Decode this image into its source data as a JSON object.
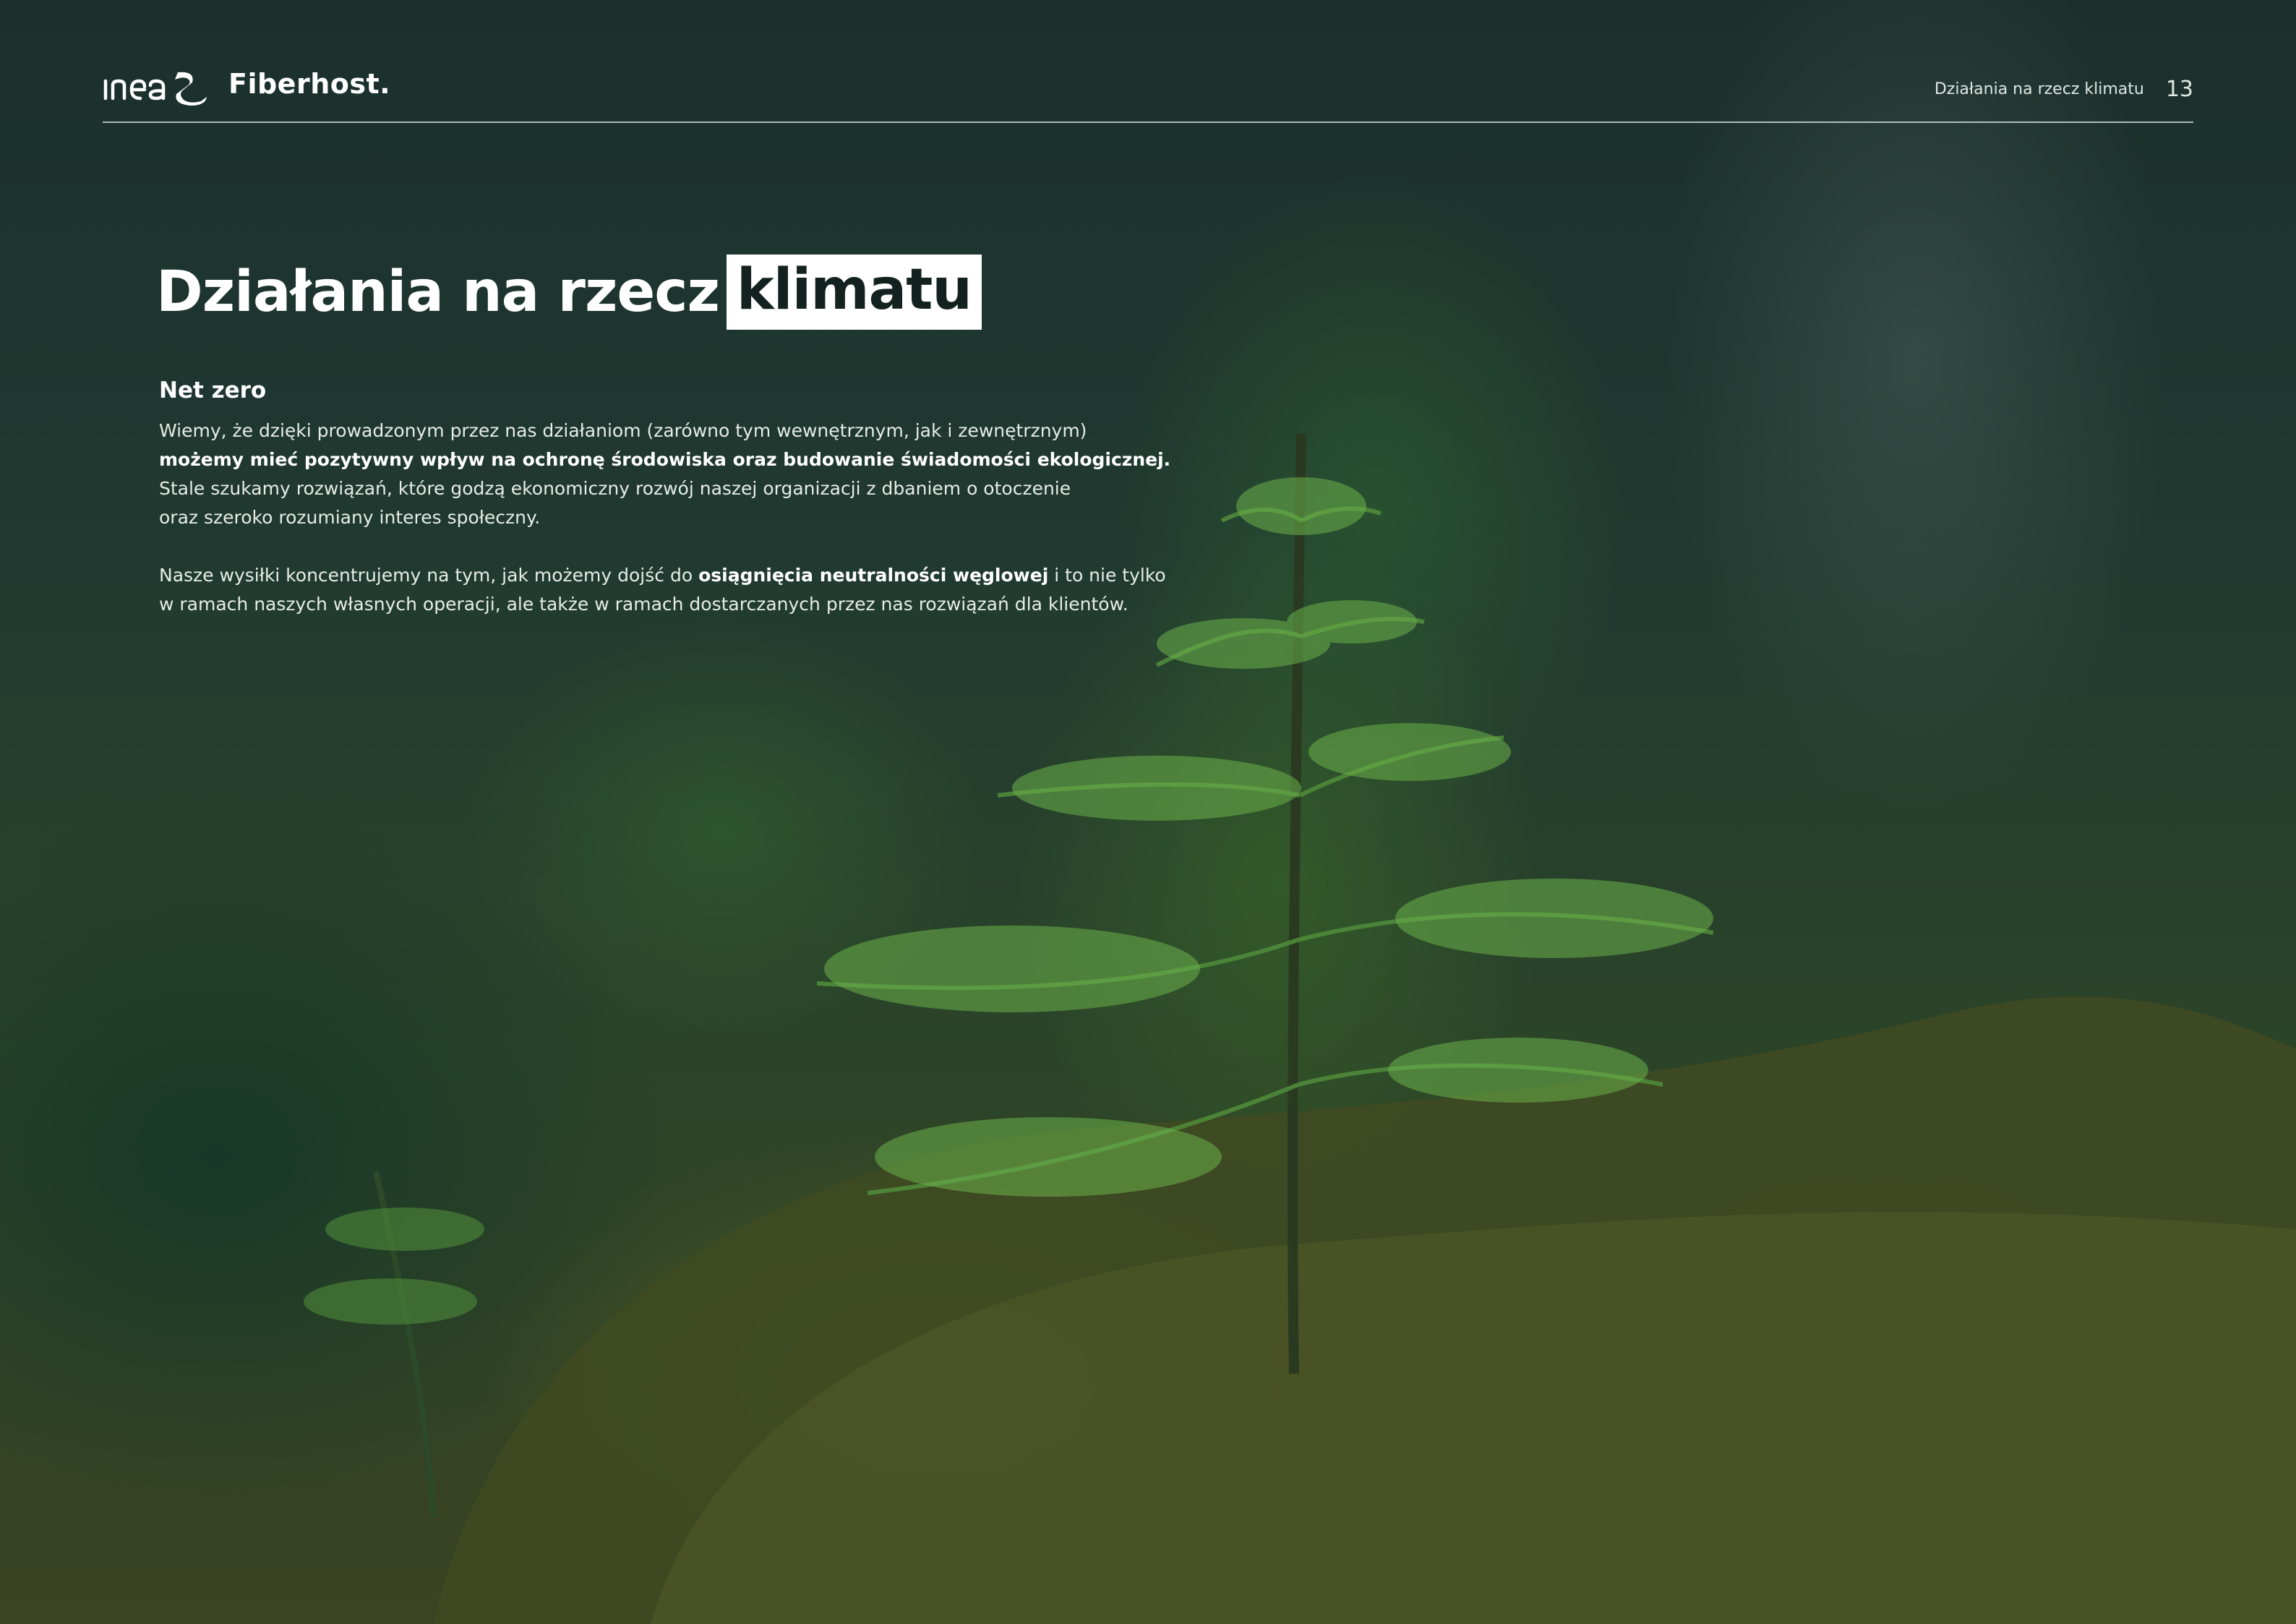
{
  "header": {
    "logo_primary": "inea",
    "logo_secondary": "Fiberhost.",
    "section_label": "Działania na rzecz klimatu",
    "page_number": "13"
  },
  "title": {
    "main": "Działania na rzecz",
    "highlight": "klimatu"
  },
  "net_zero": {
    "heading": "Net zero",
    "p1_line1": "Wiemy, że dzięki prowadzonym przez nas działaniom (zarówno tym wewnętrznym, jak i zewnętrznym)",
    "p1_line2_bold": "możemy mieć pozytywny wpływ na ochronę środowiska oraz budowanie świadomości ekologicznej.",
    "p1_line3": "Stale szukamy rozwiązań, które godzą ekonomiczny rozwój naszej organizacji z dbaniem o otoczenie",
    "p1_line4": "oraz szeroko rozumiany interes społeczny.",
    "p2_line1_a": "Nasze wysiłki koncentrujemy na tym, jak możemy dojść do",
    "p2_line1_bold": "osiągnięcia neutralności węglowej",
    "p2_line1_b": "i to nie tylko",
    "p2_line2": "w ramach naszych własnych operacji, ale także w ramach dostarczanych przez nas rozwiązań dla klientów."
  },
  "colors": {
    "background_dark": "#1d3430",
    "text_light": "#e6ece8",
    "highlight_bg": "#ffffff",
    "highlight_text": "#14221f"
  }
}
